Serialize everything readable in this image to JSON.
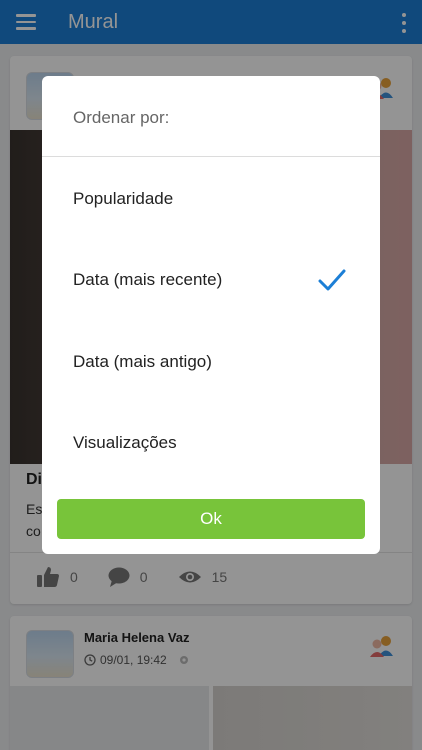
{
  "appbar": {
    "title": "Mural",
    "menu_icon": "hamburger-menu-icon",
    "more_icon": "more-vertical-icon",
    "color": "#1c7fd6"
  },
  "feed": {
    "post1": {
      "title": "Di",
      "excerpt_line1": "Es",
      "excerpt_line2": "co",
      "stats": {
        "likes": "0",
        "comments": "0",
        "views": "15"
      }
    },
    "post2": {
      "author": "Maria Helena Vaz",
      "time": "09/01, 19:42"
    }
  },
  "dialog": {
    "title": "Ordenar por:",
    "options": [
      {
        "label": "Popularidade",
        "selected": false
      },
      {
        "label": "Data (mais recente)",
        "selected": true
      },
      {
        "label": "Data (mais antigo)",
        "selected": false
      },
      {
        "label": "Visualizações",
        "selected": false
      }
    ],
    "ok_label": "Ok",
    "ok_color": "#78c43a",
    "check_color": "#1c7fd6"
  }
}
